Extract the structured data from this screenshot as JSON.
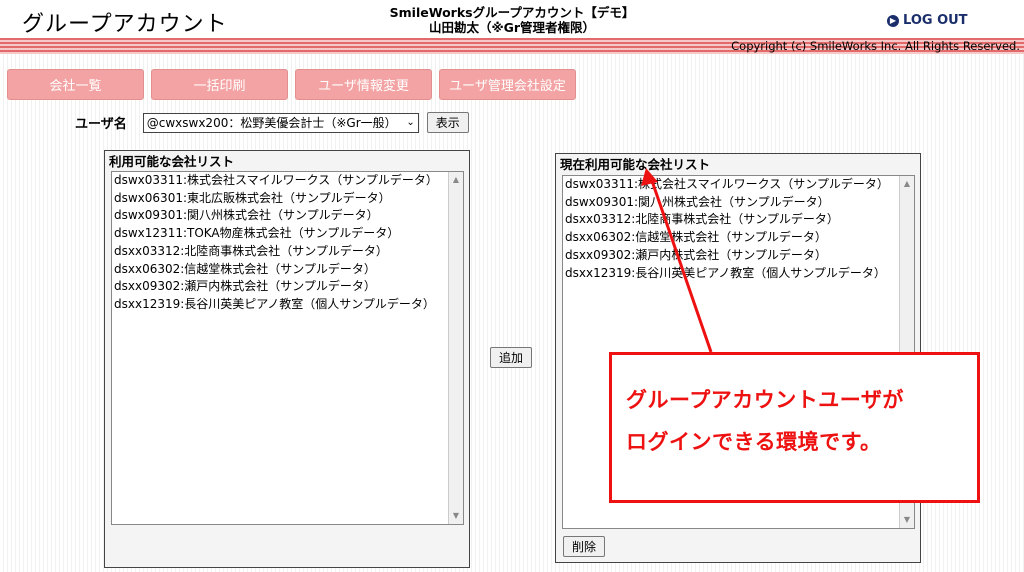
{
  "header": {
    "page_title": "グループアカウント",
    "center_line1": "SmileWorksグループアカウント【デモ】",
    "center_line2": "山田勘太（※Gr管理者権限）",
    "logout_label": "LOG OUT",
    "copyright": "Copyright (c) SmileWorks Inc. All Rights Reserved."
  },
  "nav": {
    "items": [
      "会社一覧",
      "一括印刷",
      "ユーザ情報変更",
      "ユーザ管理会社設定"
    ]
  },
  "user": {
    "label": "ユーザ名",
    "selected": "@cwxswx200：松野美優会計士（※Gr一般）",
    "show_button": "表示"
  },
  "available": {
    "title": "利用可能な会社リスト",
    "items": [
      "dswx03311:株式会社スマイルワークス（サンプルデータ）",
      "dswx06301:東北広販株式会社（サンプルデータ）",
      "dswx09301:関八州株式会社（サンプルデータ）",
      "dswx12311:TOKA物産株式会社（サンプルデータ）",
      "dsxx03312:北陸商事株式会社（サンプルデータ）",
      "dsxx06302:信越堂株式会社（サンプルデータ）",
      "dsxx09302:瀬戸内株式会社（サンプルデータ）",
      "dsxx12319:長谷川英美ピアノ教室（個人サンプルデータ）"
    ]
  },
  "add_button": "追加",
  "current": {
    "title": "現在利用可能な会社リスト",
    "items": [
      "dswx03311:株式会社スマイルワークス（サンプルデータ）",
      "dswx09301:関八州株式会社（サンプルデータ）",
      "dsxx03312:北陸商事株式会社（サンプルデータ）",
      "dsxx06302:信越堂株式会社（サンプルデータ）",
      "dsxx09302:瀬戸内株式会社（サンプルデータ）",
      "dsxx12319:長谷川英美ピアノ教室（個人サンプルデータ）"
    ],
    "delete_button": "削除"
  },
  "callout": {
    "line1": "グループアカウントユーザが",
    "line2": "ログインできる環境です。"
  },
  "colors": {
    "accent_red": "#e11111",
    "nav_pink": "#f3a3a3",
    "logout_blue": "#1a2e6b"
  },
  "icons": {
    "logout": "circle-arrow-icon",
    "select": "chevron-down-icon",
    "scroll_up": "triangle-up-icon",
    "scroll_down": "triangle-down-icon"
  }
}
